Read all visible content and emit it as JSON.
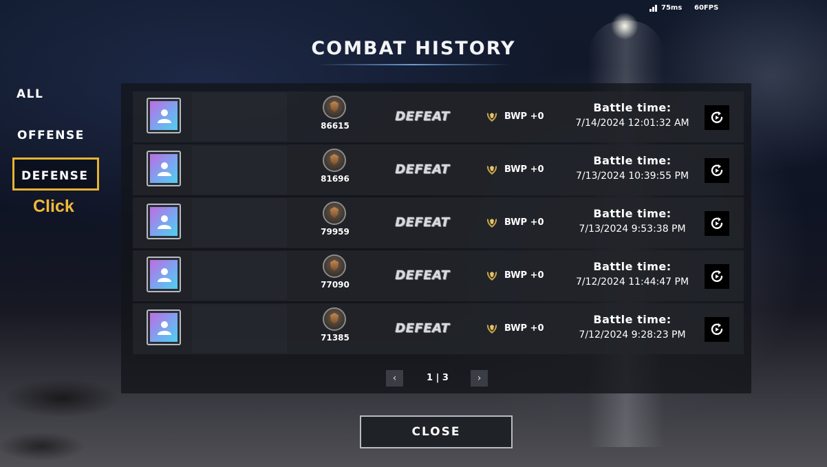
{
  "status": {
    "ping": "75ms",
    "fps": "60FPS"
  },
  "title": "COMBAT HISTORY",
  "tabs": [
    {
      "label": "ALL"
    },
    {
      "label": "OFFENSE"
    },
    {
      "label": "DEFENSE"
    }
  ],
  "selected_tab": "DEFENSE",
  "annotation": {
    "click_label": "Click",
    "highlight_color": "#e8b431"
  },
  "battle_time_label": "Battle time:",
  "entries": [
    {
      "score": "86615",
      "result": "DEFEAT",
      "bwp": "BWP +0",
      "time": "7/14/2024 12:01:32 AM"
    },
    {
      "score": "81696",
      "result": "DEFEAT",
      "bwp": "BWP +0",
      "time": "7/13/2024 10:39:55 PM"
    },
    {
      "score": "79959",
      "result": "DEFEAT",
      "bwp": "BWP +0",
      "time": "7/13/2024 9:53:38 PM"
    },
    {
      "score": "77090",
      "result": "DEFEAT",
      "bwp": "BWP +0",
      "time": "7/12/2024 11:44:47 PM"
    },
    {
      "score": "71385",
      "result": "DEFEAT",
      "bwp": "BWP +0",
      "time": "7/12/2024 9:28:23 PM"
    }
  ],
  "pagination": {
    "text": "1 | 3",
    "prev_icon": "chevron-left-icon",
    "next_icon": "chevron-right-icon"
  },
  "close_label": "CLOSE",
  "icons": {
    "avatar": "user-silhouette-icon",
    "rank": "rank-shield-badge-icon",
    "bwp": "laurel-emblem-icon",
    "replay": "replay-icon"
  }
}
